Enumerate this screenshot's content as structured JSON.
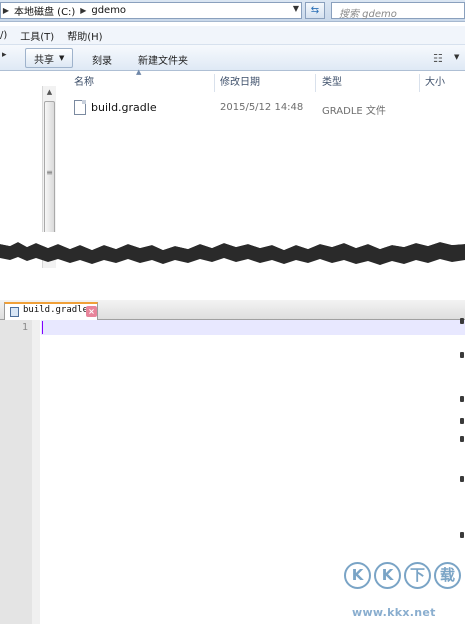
{
  "explorer": {
    "breadcrumbs": [
      "本地磁盘 (C:)",
      "gdemo"
    ],
    "search_placeholder": "搜索 gdemo",
    "menu": [
      "/)",
      "工具(T)",
      "帮助(H)"
    ],
    "toolbar": {
      "share_label": "共享",
      "burn_label": "刻录",
      "new_folder_label": "新建文件夹"
    },
    "columns": {
      "name": "名称",
      "modified": "修改日期",
      "type": "类型",
      "size": "大小"
    },
    "files": [
      {
        "name": "build.gradle",
        "modified": "2015/5/12 14:48",
        "type": "GRADLE 文件",
        "size": ""
      }
    ]
  },
  "editor": {
    "tab_label": "build.gradle",
    "line_numbers": [
      "1"
    ]
  },
  "watermark": {
    "badges": [
      "K",
      "K",
      "下",
      "载"
    ],
    "url": "www.kkx.net"
  },
  "colors": {
    "editor_current_line": "#e8e8ff",
    "editor_caret": "#8000ff",
    "tab_accent": "#f0a038",
    "explorer_toolbar": "#dfe9f5"
  }
}
